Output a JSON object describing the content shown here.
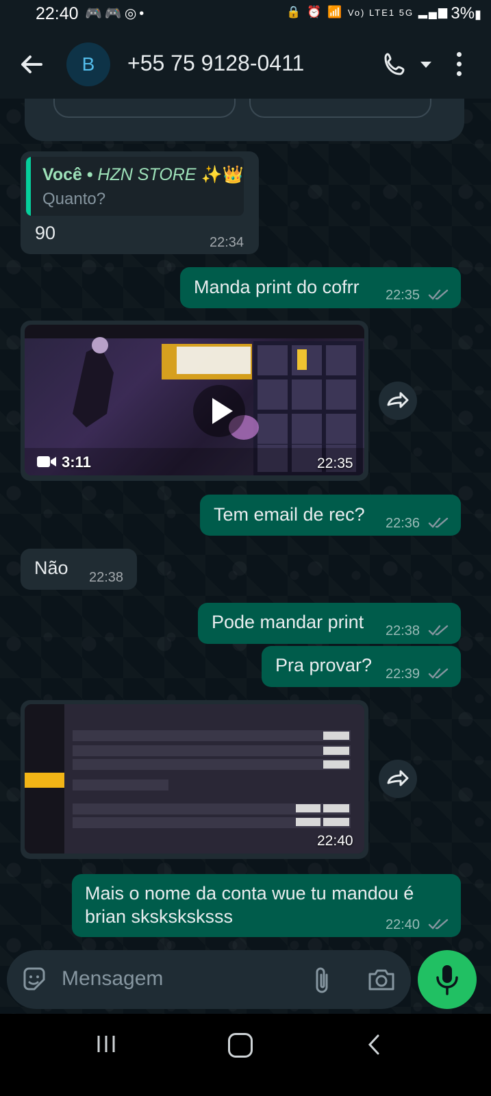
{
  "status_bar": {
    "time": "22:40",
    "left_icons": [
      "discord-icon",
      "discord-icon",
      "whatsapp-icon",
      "dot"
    ],
    "network": "Vo) LTE1 5G",
    "battery": "3%"
  },
  "header": {
    "avatar_initial": "B",
    "contact": "+55 75 9128-0411"
  },
  "messages": {
    "m1": {
      "quote_author": "Você • ",
      "quote_store": "HZN STORE",
      "quote_emoji": "✨👑",
      "quote_text": "Quanto?",
      "text": "90",
      "time": "22:34"
    },
    "m2": {
      "text": "Manda print do cofrr",
      "time": "22:35"
    },
    "m3": {
      "duration": "3:11",
      "time": "22:35"
    },
    "m4": {
      "text": "Tem email de rec?",
      "time": "22:36"
    },
    "m5": {
      "text": "Não",
      "time": "22:38"
    },
    "m6": {
      "text": "Pode mandar print",
      "time": "22:38"
    },
    "m7": {
      "text": "Pra provar?",
      "time": "22:39"
    },
    "m8": {
      "time": "22:40"
    },
    "m9": {
      "text_line1": "Mais o nome da conta wue tu mandou é",
      "text_line2": "brian sksksksksss",
      "time": "22:40"
    }
  },
  "input": {
    "placeholder": "Mensagem"
  },
  "colors": {
    "incoming": "#202c33",
    "outgoing": "#005c4b",
    "accent": "#21c063",
    "background": "#0b141a"
  }
}
